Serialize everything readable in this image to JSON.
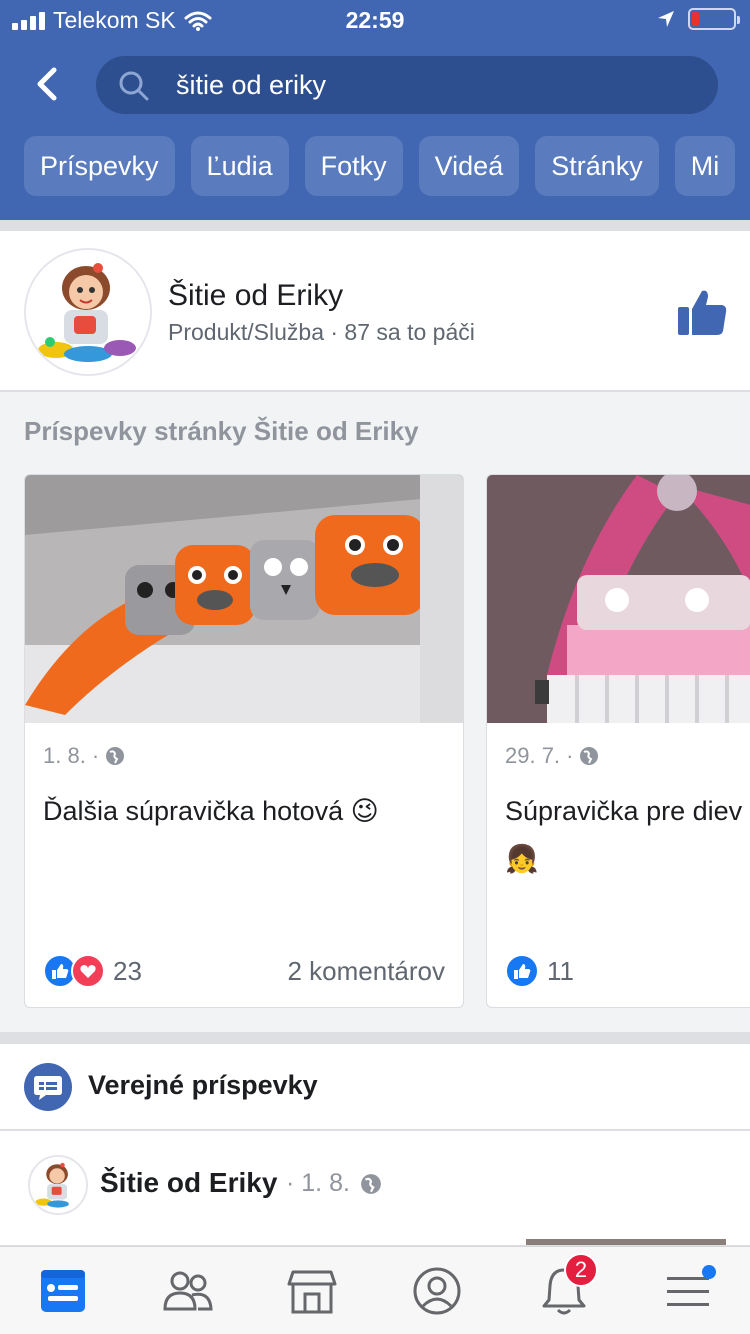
{
  "status_bar": {
    "carrier": "Telekom SK",
    "time": "22:59"
  },
  "header": {
    "search_query": "šitie od eriky",
    "tabs": [
      "Príspevky",
      "Ľudia",
      "Fotky",
      "Videá",
      "Stránky",
      "Mi"
    ]
  },
  "page_result": {
    "name": "Šitie od Eriky",
    "meta": "Produkt/Služba · 87 sa to páči"
  },
  "posts_section": {
    "title": "Príspevky stránky Šitie od Eriky",
    "posts": [
      {
        "date": "1. 8. ·",
        "text": "Ďalšia súpravička hotová 😉",
        "reaction_count": "23",
        "comments": "2 komentárov"
      },
      {
        "date": "29. 7. ·",
        "text": "Súpravička pre diev",
        "emoji": "👧",
        "reaction_count": "11"
      }
    ]
  },
  "public_posts": {
    "title": "Verejné príspevky",
    "first_post": {
      "author": "Šitie od Eriky",
      "date": "· 1. 8."
    }
  },
  "tabbar": {
    "notifications_badge": "2"
  },
  "colors": {
    "brand_blue": "#4267b2",
    "like_blue": "#1877f2",
    "love_red": "#f33e58",
    "badge_red": "#e41e3f"
  }
}
